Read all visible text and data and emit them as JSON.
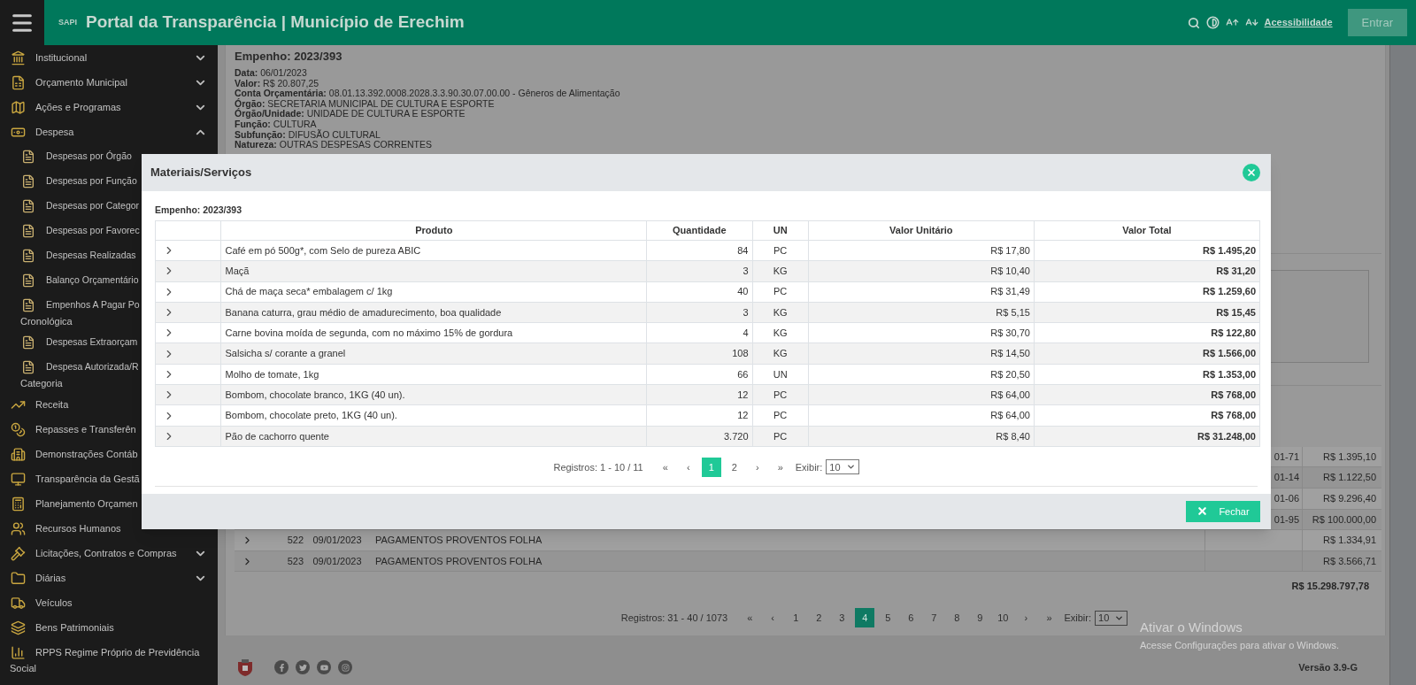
{
  "header": {
    "logo_text": "SAPI",
    "title": "Portal da Transparência | Município de Erechim",
    "accessibility_link": "Acessibilidade",
    "login_button": "Entrar"
  },
  "sidebar": {
    "items": [
      {
        "label": "Institucional",
        "expanded": false
      },
      {
        "label": "Orçamento Municipal",
        "expanded": false
      },
      {
        "label": "Ações e Programas",
        "expanded": false
      },
      {
        "label": "Despesa",
        "expanded": true,
        "children": [
          {
            "label": "Despesas por Órgão"
          },
          {
            "label": "Despesas por Função"
          },
          {
            "label": "Despesas por Categor"
          },
          {
            "label": "Despesas por Favorec"
          },
          {
            "label": "Despesas Realizadas"
          },
          {
            "label": "Balanço Orçamentário"
          },
          {
            "label": "Empenhos A Pagar Po",
            "label_continued": "Cronológica"
          },
          {
            "label": "Despesas Extraorçam"
          },
          {
            "label": "Despesa Autorizada/R",
            "label_continued": "Categoria"
          }
        ]
      },
      {
        "label": "Receita"
      },
      {
        "label": "Repasses e Transferên"
      },
      {
        "label": "Demonstrações Contáb"
      },
      {
        "label": "Transparência da Gestã"
      },
      {
        "label": "Planejamento Orçamen"
      },
      {
        "label": "Recursos Humanos"
      },
      {
        "label": "Licitações, Contratos e Compras",
        "expanded": false
      },
      {
        "label": "Diárias",
        "expanded": false
      },
      {
        "label": "Veículos"
      },
      {
        "label": "Bens Patrimoniais"
      },
      {
        "label": "RPPS Regime Próprio de Previdência",
        "label_continued": "Social"
      }
    ]
  },
  "empenho": {
    "heading": "Empenho: 2023/393",
    "fields": [
      "**Data:** 06/01/2023",
      "**Valor:** R$ 20.807,25",
      "**Conta Orçamentária:** 08.01.13.392.0008.2028.3.3.90.30.07.00.00 - Gêneros de Alimentação",
      "**Órgão:** SECRETARIA MUNICIPAL DE CULTURA E ESPORTE",
      "**Órgão/Unidade:** UNIDADE DE CULTURA E ESPORTE",
      "**Função:** CULTURA",
      "**Subfunção:** DIFUSÃO CULTURAL",
      "**Natureza:** OUTRAS DESPESAS CORRENTES"
    ]
  },
  "payments": {
    "rows": [
      {
        "code": "01-71",
        "value": "R$ 1.395,10"
      },
      {
        "code": "01-14",
        "value": "R$ 1.122,50"
      },
      {
        "code": "01-06",
        "value": "R$ 9.296,40"
      },
      {
        "code": "01-95",
        "value": "R$ 100.000,00"
      },
      {
        "number": "522",
        "date": "09/01/2023",
        "description": "PAGAMENTOS PROVENTOS FOLHA",
        "value": "R$ 1.334,91"
      },
      {
        "number": "523",
        "date": "09/01/2023",
        "description": "PAGAMENTOS PROVENTOS FOLHA",
        "value": "R$ 3.566,71"
      }
    ],
    "total": "R$ 15.298.797,78",
    "pagination": {
      "records": "Registros: 31 - 40 / 1073",
      "pages": [
        {
          "label": "«",
          "selected": false
        },
        {
          "label": "‹",
          "selected": false
        },
        {
          "label": "1",
          "selected": false
        },
        {
          "label": "2",
          "selected": false
        },
        {
          "label": "3",
          "selected": false
        },
        {
          "label": "4",
          "selected": true
        },
        {
          "label": "5",
          "selected": false
        },
        {
          "label": "6",
          "selected": false
        },
        {
          "label": "7",
          "selected": false
        },
        {
          "label": "8",
          "selected": false
        },
        {
          "label": "9",
          "selected": false
        },
        {
          "label": "10",
          "selected": false
        },
        {
          "label": "›",
          "selected": false
        },
        {
          "label": "»",
          "selected": false
        }
      ],
      "show_label": "Exibir:",
      "page_size": "10"
    }
  },
  "modal": {
    "title": "Materiais/Serviços",
    "subtitle": "Empenho: 2023/393",
    "columns": [
      "Produto",
      "Quantidade",
      "UN",
      "Valor Unitário",
      "Valor Total"
    ],
    "rows": [
      {
        "product": "Café em pó 500g*, com Selo de pureza ABIC",
        "quantity": "84",
        "unit": "PC",
        "unit_value": "R$ 17,80",
        "total": "R$ 1.495,20"
      },
      {
        "product": "Maçã",
        "quantity": "3",
        "unit": "KG",
        "unit_value": "R$ 10,40",
        "total": "R$ 31,20"
      },
      {
        "product": "Chá de maça seca* embalagem c/ 1kg",
        "quantity": "40",
        "unit": "PC",
        "unit_value": "R$ 31,49",
        "total": "R$ 1.259,60"
      },
      {
        "product": "Banana caturra, grau médio de amadurecimento, boa qualidade",
        "quantity": "3",
        "unit": "KG",
        "unit_value": "R$ 5,15",
        "total": "R$ 15,45"
      },
      {
        "product": "Carne bovina moída de segunda, com no máximo 15% de gordura",
        "quantity": "4",
        "unit": "KG",
        "unit_value": "R$ 30,70",
        "total": "R$ 122,80"
      },
      {
        "product": "Salsicha s/ corante a granel",
        "quantity": "108",
        "unit": "KG",
        "unit_value": "R$ 14,50",
        "total": "R$ 1.566,00"
      },
      {
        "product": "Molho de tomate, 1kg",
        "quantity": "66",
        "unit": "UN",
        "unit_value": "R$ 20,50",
        "total": "R$ 1.353,00"
      },
      {
        "product": "Bombom, chocolate branco, 1KG (40 un).",
        "quantity": "12",
        "unit": "PC",
        "unit_value": "R$ 64,00",
        "total": "R$ 768,00"
      },
      {
        "product": "Bombom, chocolate preto, 1KG (40 un).",
        "quantity": "12",
        "unit": "PC",
        "unit_value": "R$ 64,00",
        "total": "R$ 768,00"
      },
      {
        "product": "Pão de cachorro quente",
        "quantity": "3.720",
        "unit": "PC",
        "unit_value": "R$ 8,40",
        "total": "R$ 31.248,00"
      }
    ],
    "pagination": {
      "records": "Registros: 1 - 10 / 11",
      "pages": [
        {
          "label": "«",
          "selected": false
        },
        {
          "label": "‹",
          "selected": false
        },
        {
          "label": "1",
          "selected": true
        },
        {
          "label": "2",
          "selected": false
        },
        {
          "label": "›",
          "selected": false
        },
        {
          "label": "»",
          "selected": false
        }
      ],
      "show_label": "Exibir:",
      "page_size": "10"
    },
    "close_button": "Fechar"
  },
  "footer": {
    "version": "Versão 3.9-G"
  },
  "os_notice": {
    "title": "Ativar o Windows",
    "text": "Acesse Configurações para ativar o Windows."
  }
}
